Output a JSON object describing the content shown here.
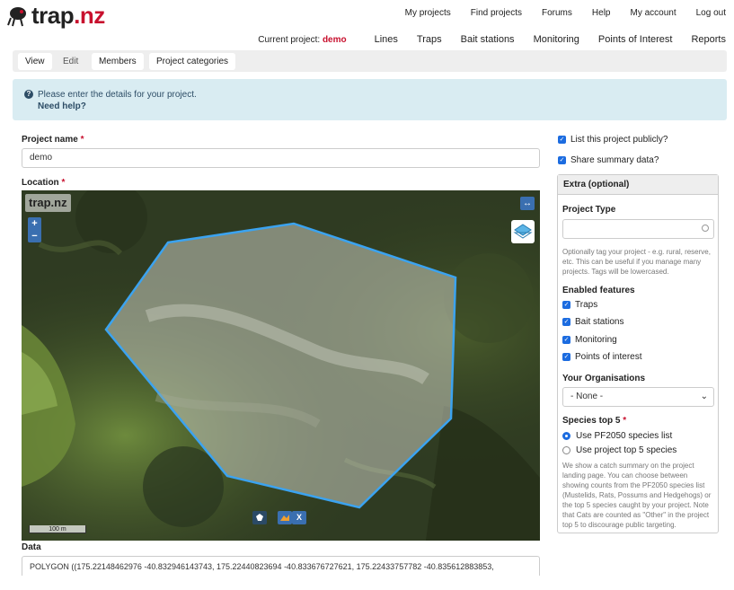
{
  "brand": {
    "name_main": "trap",
    "name_tld": ".nz",
    "accent": "#c8102e"
  },
  "topnav": [
    "My projects",
    "Find projects",
    "Forums",
    "Help",
    "My account",
    "Log out"
  ],
  "subnav": {
    "current_label": "Current project:",
    "current_value": "demo",
    "items": [
      "Lines",
      "Traps",
      "Bait stations",
      "Monitoring",
      "Points of Interest",
      "Reports"
    ]
  },
  "tabs": [
    "View",
    "Edit",
    "Members",
    "Project categories"
  ],
  "info": {
    "message": "Please enter the details for your project.",
    "help": "Need help?"
  },
  "form": {
    "project_name_label": "Project name",
    "project_name_value": "demo",
    "location_label": "Location",
    "data_label": "Data",
    "data_value": "POLYGON ((175.22148462976 -40.832946143743, 175.22440823694 -40.833676727621, 175.22433757782 -40.835612883853,"
  },
  "map": {
    "logo": "trap.nz",
    "zoom_in": "+",
    "zoom_out": "−",
    "expand_icon": "↔",
    "scale_label": "100 m",
    "clear_label": "X"
  },
  "options": {
    "list_publicly": "List this project publicly?",
    "share_summary": "Share summary data?"
  },
  "extra": {
    "title": "Extra (optional)",
    "project_type_label": "Project Type",
    "project_type_hint": "Optionally tag your project - e.g. rural, reserve, etc. This can be useful if you manage many projects. Tags will be lowercased.",
    "enabled_label": "Enabled features",
    "features": [
      "Traps",
      "Bait stations",
      "Monitoring",
      "Points of interest"
    ],
    "org_label": "Your Organisations",
    "org_value": "- None -",
    "species_label": "Species top 5",
    "species_options": [
      "Use PF2050 species list",
      "Use project top 5 species"
    ],
    "species_hint": "We show a catch summary on the project landing page. You can choose between showing counts from the PF2050 species list (Mustelids, Rats, Possums and Hedgehogs) or the top 5 species caught by your project. Note that Cats are counted as \"Other\" in the project top 5 to discourage public targeting."
  }
}
